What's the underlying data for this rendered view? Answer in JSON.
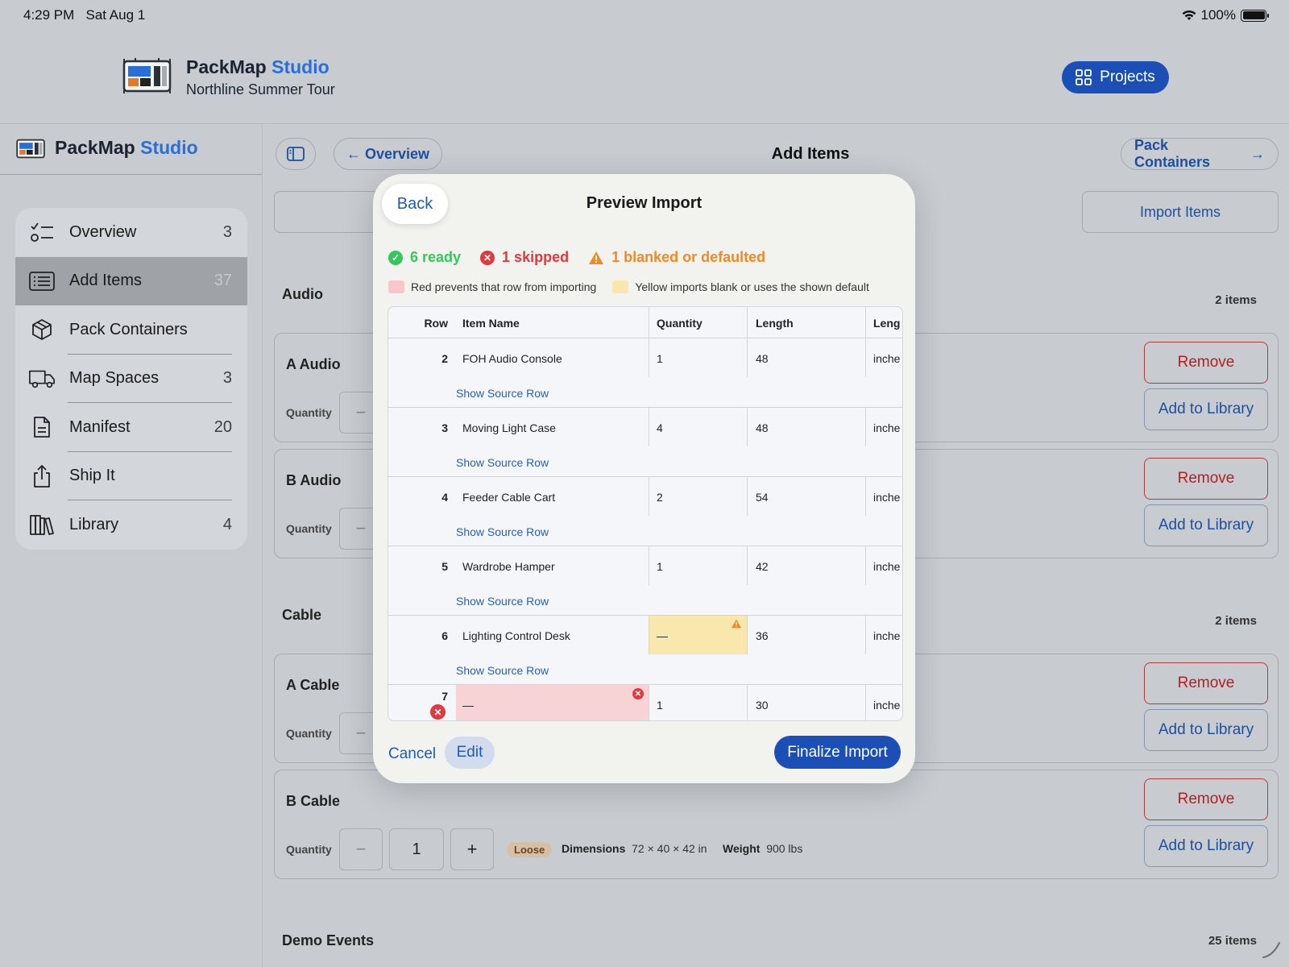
{
  "status": {
    "time": "4:29 PM",
    "date": "Sat Aug 1",
    "battery": "100%"
  },
  "header": {
    "brand_main": "PackMap",
    "brand_accent": "Studio",
    "subtitle": "Northline Summer Tour",
    "projects_label": "Projects"
  },
  "sidebar": {
    "brand_main": "PackMap",
    "brand_accent": "Studio",
    "items": [
      {
        "label": "Overview",
        "count": "3",
        "icon": "checklist-icon"
      },
      {
        "label": "Add Items",
        "count": "37",
        "icon": "list-icon"
      },
      {
        "label": "Pack Containers",
        "count": "",
        "icon": "box-icon"
      },
      {
        "label": "Map Spaces",
        "count": "3",
        "icon": "truck-icon"
      },
      {
        "label": "Manifest",
        "count": "20",
        "icon": "document-icon"
      },
      {
        "label": "Ship It",
        "count": "",
        "icon": "share-icon"
      },
      {
        "label": "Library",
        "count": "4",
        "icon": "books-icon"
      }
    ]
  },
  "main": {
    "back_label": "Overview",
    "title": "Add Items",
    "next_label": "Pack Containers",
    "tab_right": "Import Items",
    "sections": [
      {
        "title": "Audio",
        "count": "2 items"
      },
      {
        "title": "Cable",
        "count": "2 items"
      },
      {
        "title": "Demo Events",
        "count": "25 items"
      }
    ],
    "cards": [
      {
        "name": "A Audio",
        "qty_label": "Quantity",
        "remove": "Remove",
        "add": "Add to Library"
      },
      {
        "name": "B Audio",
        "qty_label": "Quantity",
        "remove": "Remove",
        "add": "Add to Library"
      },
      {
        "name": "A Cable",
        "qty_label": "Quantity",
        "remove": "Remove",
        "add": "Add to Library"
      },
      {
        "name": "B Cable",
        "qty_label": "Quantity",
        "qty": "1",
        "tag": "Loose",
        "dims_label": "Dimensions",
        "dims": "72 × 40 × 42 in",
        "weight_label": "Weight",
        "weight": "900 lbs",
        "remove": "Remove",
        "add": "Add to Library"
      }
    ]
  },
  "modal": {
    "back": "Back",
    "title": "Preview Import",
    "ready": "6 ready",
    "skipped": "1 skipped",
    "blanked": "1 blanked or defaulted",
    "legend_red": "Red prevents that row from importing",
    "legend_yellow": "Yellow imports blank or uses the shown default",
    "columns": [
      "Row",
      "Item Name",
      "Quantity",
      "Length",
      "Leng"
    ],
    "source_label": "Show Source Row",
    "rows": [
      {
        "row": "2",
        "name": "FOH Audio Console",
        "qty": "1",
        "len": "48",
        "unit": "inche"
      },
      {
        "row": "3",
        "name": "Moving Light Case",
        "qty": "4",
        "len": "48",
        "unit": "inche"
      },
      {
        "row": "4",
        "name": "Feeder Cable Cart",
        "qty": "2",
        "len": "54",
        "unit": "inche"
      },
      {
        "row": "5",
        "name": "Wardrobe Hamper",
        "qty": "1",
        "len": "42",
        "unit": "inche"
      },
      {
        "row": "6",
        "name": "Lighting Control Desk",
        "qty": "—",
        "len": "36",
        "unit": "inche"
      },
      {
        "row": "7",
        "name": "—",
        "qty": "1",
        "len": "30",
        "unit": "inche"
      }
    ],
    "cancel": "Cancel",
    "edit": "Edit",
    "finalize": "Finalize Import"
  },
  "colors": {
    "accent": "#1b4fb5",
    "ready": "#34c759",
    "skipped": "#e0393e",
    "warning": "#f08a24"
  }
}
